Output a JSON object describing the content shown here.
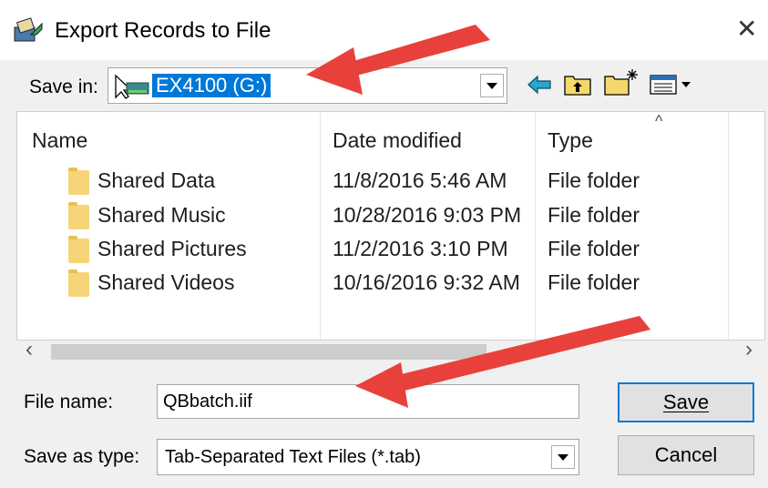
{
  "window": {
    "title": "Export Records to File",
    "close_glyph": "✕"
  },
  "save_in": {
    "label": "Save in:",
    "value": "EX4100 (G:)"
  },
  "toolbar_icons": [
    "back-arrow-icon",
    "up-folder-icon",
    "new-folder-icon",
    "view-menu-icon"
  ],
  "file_list": {
    "columns": [
      "Name",
      "Date modified",
      "Type"
    ],
    "rows": [
      {
        "name": "Shared Data",
        "date": "11/8/2016 5:46 AM",
        "type": "File folder"
      },
      {
        "name": "Shared Music",
        "date": "10/28/2016 9:03 PM",
        "type": "File folder"
      },
      {
        "name": "Shared Pictures",
        "date": "11/2/2016 3:10 PM",
        "type": "File folder"
      },
      {
        "name": "Shared Videos",
        "date": "10/16/2016 9:32 AM",
        "type": "File folder"
      }
    ]
  },
  "scrollbar": {
    "left_glyph": "‹",
    "right_glyph": "›"
  },
  "file_name": {
    "label": "File name:",
    "value": "QBbatch.iif"
  },
  "save_as_type": {
    "label": "Save as type:",
    "value": "Tab-Separated Text Files (*.tab)"
  },
  "buttons": {
    "save": "Save",
    "cancel": "Cancel"
  },
  "colors": {
    "annotation_arrow": "#e8413c",
    "selection": "#0078d7",
    "folder": "#f7d478"
  }
}
